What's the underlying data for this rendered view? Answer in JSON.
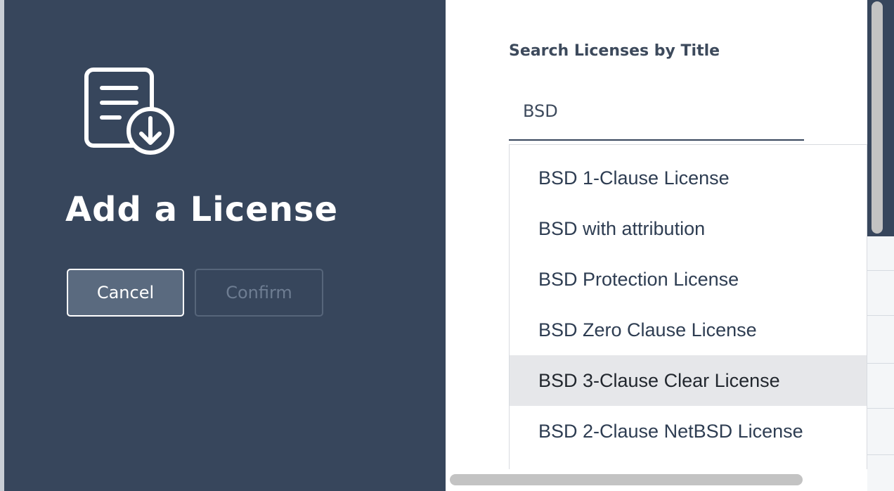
{
  "dialog": {
    "title": "Add a License",
    "cancel_label": "Cancel",
    "confirm_label": "Confirm",
    "icon": "document-download-icon"
  },
  "search": {
    "label": "Search Licenses by Title",
    "value": "BSD"
  },
  "results": [
    {
      "label": "BSD 1-Clause License",
      "highlighted": false
    },
    {
      "label": "BSD with attribution",
      "highlighted": false
    },
    {
      "label": "BSD Protection License",
      "highlighted": false
    },
    {
      "label": "BSD Zero Clause License",
      "highlighted": false
    },
    {
      "label": "BSD 3-Clause Clear License",
      "highlighted": true
    },
    {
      "label": "BSD 2-Clause NetBSD License",
      "highlighted": false
    }
  ],
  "colors": {
    "panel_dark": "#37465c",
    "highlight": "#e6e7ea",
    "text": "#2e3d52"
  }
}
